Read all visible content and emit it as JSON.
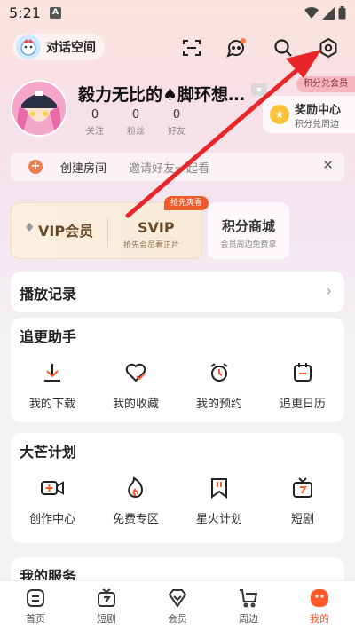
{
  "status": {
    "time": "5:21",
    "notif_icon": "A"
  },
  "topbar": {
    "space_label": "对话空间"
  },
  "profile": {
    "username": "毅力无比的♠脚环想…",
    "stats": [
      {
        "num": "0",
        "label": "关注"
      },
      {
        "num": "0",
        "label": "粉丝"
      },
      {
        "num": "0",
        "label": "好友"
      }
    ]
  },
  "reward": {
    "points_tag": "积分兑会员",
    "title": "奖励中心",
    "subtitle": "积分兑周边"
  },
  "room": {
    "title": "创建房间",
    "subtitle": "邀请好友一起看"
  },
  "vip": {
    "vip_label": "VIP会员",
    "svip_label": "SVIP",
    "svip_sub": "抢先会员看正片",
    "svip_tag": "抢先爽看"
  },
  "mall": {
    "title": "积分商城",
    "subtitle": "会员周边免费拿"
  },
  "history": {
    "label": "播放记录"
  },
  "follow_section": {
    "title": "追更助手",
    "items": [
      {
        "label": "我的下载",
        "icon": "download-icon"
      },
      {
        "label": "我的收藏",
        "icon": "heart-check-icon"
      },
      {
        "label": "我的预约",
        "icon": "alarm-icon"
      },
      {
        "label": "追更日历",
        "icon": "calendar-icon"
      }
    ]
  },
  "plan_section": {
    "title": "大芒计划",
    "items": [
      {
        "label": "创作中心",
        "icon": "video-plus-icon"
      },
      {
        "label": "免费专区",
        "icon": "flame-icon"
      },
      {
        "label": "星火计划",
        "icon": "bookmark-icon"
      },
      {
        "label": "短剧",
        "icon": "tv-icon"
      }
    ]
  },
  "service_section": {
    "title": "我的服务"
  },
  "bottom_nav": [
    {
      "label": "首页",
      "icon": "home-icon"
    },
    {
      "label": "短剧",
      "icon": "tv-icon"
    },
    {
      "label": "会员",
      "icon": "diamond-icon"
    },
    {
      "label": "周边",
      "icon": "cart-icon"
    },
    {
      "label": "我的",
      "icon": "me-icon",
      "active": true
    }
  ],
  "colors": {
    "accent": "#ff5a2b",
    "arrow": "#e8262a",
    "vip_text": "#6b4b2a"
  }
}
